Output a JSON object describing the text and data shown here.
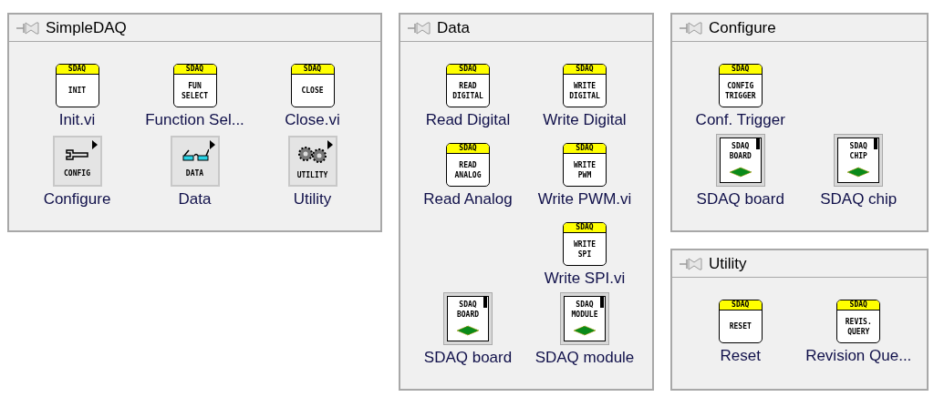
{
  "palettes": [
    {
      "title": "SimpleDAQ",
      "items": [
        {
          "kind": "vi",
          "header": "SDAQ",
          "lines": [
            "INIT"
          ],
          "label": "Init.vi"
        },
        {
          "kind": "vi",
          "header": "SDAQ",
          "lines": [
            "FUN",
            "SELECT"
          ],
          "label": "Function Sel..."
        },
        {
          "kind": "vi",
          "header": "SDAQ",
          "lines": [
            "CLOSE"
          ],
          "label": "Close.vi"
        },
        {
          "kind": "wrench-menu",
          "lines": [
            "CONFIG"
          ],
          "label": "Configure"
        },
        {
          "kind": "glasses-menu",
          "lines": [
            "DATA"
          ],
          "label": "Data"
        },
        {
          "kind": "gears-menu",
          "lines": [
            "UTILITY"
          ],
          "label": "Utility"
        }
      ]
    },
    {
      "title": "Data",
      "items": [
        {
          "kind": "vi",
          "header": "SDAQ",
          "lines": [
            "READ",
            "DIGITAL"
          ],
          "label": "Read Digital"
        },
        {
          "kind": "vi",
          "header": "SDAQ",
          "lines": [
            "WRITE",
            "DIGITAL"
          ],
          "label": "Write Digital"
        },
        {
          "kind": "vi",
          "header": "SDAQ",
          "lines": [
            "READ",
            "ANALOG"
          ],
          "label": "Read Analog"
        },
        {
          "kind": "vi",
          "header": "SDAQ",
          "lines": [
            "WRITE",
            "PWM"
          ],
          "label": "Write PWM.vi"
        },
        {
          "kind": "blank"
        },
        {
          "kind": "vi",
          "header": "SDAQ",
          "lines": [
            "WRITE",
            "SPI"
          ],
          "label": "Write SPI.vi"
        },
        {
          "kind": "control",
          "lines": [
            "SDAQ",
            "BOARD"
          ],
          "label": "SDAQ board"
        },
        {
          "kind": "control",
          "lines": [
            "SDAQ",
            "MODULE"
          ],
          "label": "SDAQ module"
        }
      ]
    },
    {
      "title": "Configure",
      "items": [
        {
          "kind": "vi",
          "header": "SDAQ",
          "lines": [
            "CONFIG",
            "TRIGGER"
          ],
          "label": "Conf. Trigger"
        },
        {
          "kind": "blank"
        },
        {
          "kind": "control",
          "lines": [
            "SDAQ",
            "BOARD"
          ],
          "label": "SDAQ board"
        },
        {
          "kind": "control",
          "lines": [
            "SDAQ",
            "CHIP"
          ],
          "label": "SDAQ chip"
        }
      ]
    },
    {
      "title": "Utility",
      "items": [
        {
          "kind": "vi",
          "header": "SDAQ",
          "lines": [
            "RESET"
          ],
          "label": "Reset"
        },
        {
          "kind": "vi",
          "header": "SDAQ",
          "lines": [
            "REVIS.",
            "QUERY"
          ],
          "label": "Revision Que..."
        }
      ]
    }
  ]
}
